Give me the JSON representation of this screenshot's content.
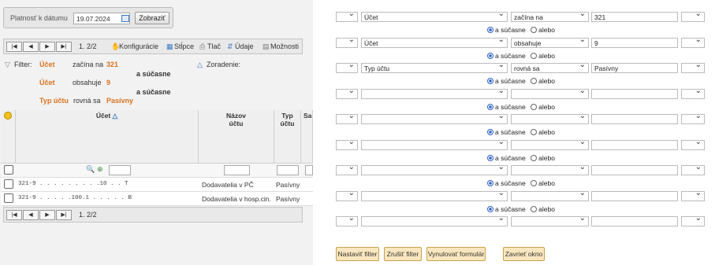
{
  "left": {
    "date_label": "Platnosť k dátumu",
    "date_value": "19.07.2024",
    "show_button": "Zobraziť",
    "pager": "1. 2/2",
    "toolbar": [
      "Konfigurácie",
      "Stĺpce",
      "Tlač",
      "Údaje",
      "Možnosti"
    ],
    "filter_label": "Filter:",
    "sort_label": "Zoradenie:",
    "filters": [
      {
        "field": "Účet",
        "op": "začína na",
        "value": "321"
      },
      {
        "join": "a súčasne"
      },
      {
        "field": "Účet",
        "op": "obsahuje",
        "value": "9"
      },
      {
        "join": "a súčasne"
      },
      {
        "field": "Typ účtu",
        "op": "rovná sa",
        "value": "Pasívny"
      }
    ],
    "columns": [
      "Účet",
      "Názov účtu",
      "Typ účtu",
      "Sa"
    ],
    "rows": [
      {
        "ucet": "321-9 . . . . . . . . .10 . . T",
        "nazov": "Dodavatelia v PČ",
        "typ": "Pasívny"
      },
      {
        "ucet": "321-9 . . . . .100.1 . . . . . B",
        "nazov": "Dodavatelia v hosp.cin.",
        "typ": "Pasívny"
      }
    ],
    "pager_bottom": "1. 2/2"
  },
  "right": {
    "conditions": [
      {
        "field": "Účet",
        "op": "začína na",
        "value": "321"
      },
      {
        "field": "Účet",
        "op": "obsahuje",
        "value": "9"
      },
      {
        "field": "Typ účtu",
        "op": "rovná sa",
        "value": "Pasívny"
      },
      {
        "field": "",
        "op": "",
        "value": ""
      },
      {
        "field": "",
        "op": "",
        "value": ""
      },
      {
        "field": "",
        "op": "",
        "value": ""
      },
      {
        "field": "",
        "op": "",
        "value": ""
      },
      {
        "field": "",
        "op": "",
        "value": ""
      },
      {
        "field": "",
        "op": "",
        "value": ""
      }
    ],
    "and_label": "a súčasne",
    "or_label": "alebo",
    "buttons": [
      "Nastaviť filter",
      "Zrušiť filter",
      "Vynulovať formulár",
      "Zavrieť okno"
    ]
  }
}
